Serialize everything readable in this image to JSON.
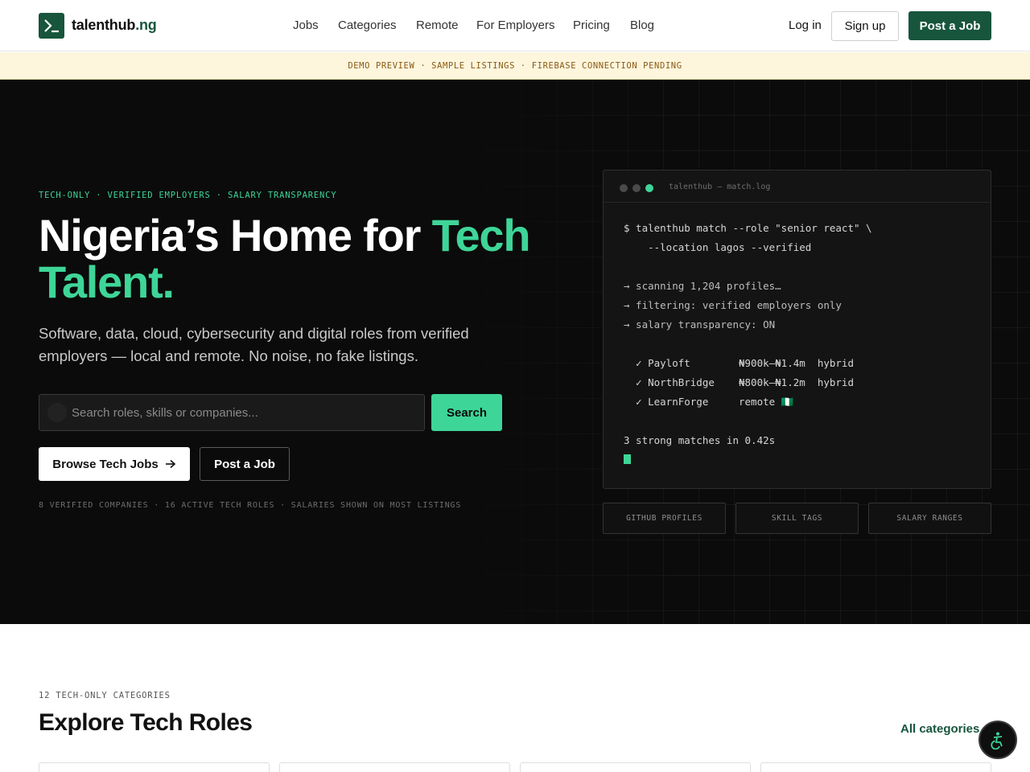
{
  "header": {
    "logo_main": "talenthub",
    "logo_tld": ".ng",
    "nav": [
      "Jobs",
      "Categories",
      "Remote",
      "For Employers",
      "Pricing",
      "Blog"
    ],
    "login": "Log in",
    "signup": "Sign up",
    "post_job": "Post a Job"
  },
  "banner": "DEMO PREVIEW · SAMPLE LISTINGS · FIREBASE CONNECTION PENDING",
  "hero": {
    "kicker": "TECH-ONLY · VERIFIED EMPLOYERS · SALARY TRANSPARENCY",
    "title_part1": "Nigeria’s Home for ",
    "title_accent": "Tech Talent.",
    "subtitle": "Software, data, cloud, cybersecurity and digital roles from verified employers — local and remote. No noise, no fake listings.",
    "search_placeholder": "Search roles, skills or companies...",
    "search_button": "Search",
    "browse_button": "Browse Tech Jobs",
    "post_button": "Post a Job",
    "stats": "8 VERIFIED COMPANIES · 16 ACTIVE TECH ROLES · SALARIES SHOWN ON MOST LISTINGS"
  },
  "terminal": {
    "title": "talenthub — match.log",
    "lines": [
      "$ talenthub match --role \"senior react\" \\",
      "    --location lagos --verified",
      "→ scanning 1,204 profiles…",
      "→ filtering: verified employers only",
      "→ salary transparency: ON",
      "  ✓ Payloft        ₦900k–₦1.4m  hybrid",
      "  ✓ NorthBridge    ₦800k–₦1.2m  hybrid",
      "  ✓ LearnForge     remote 🇳🇬",
      "3 strong matches in 0.42s"
    ],
    "chips": [
      "GITHUB PROFILES",
      "SKILL TAGS",
      "SALARY RANGES"
    ]
  },
  "categories": {
    "kicker": "12 TECH-ONLY CATEGORIES",
    "title": "Explore Tech Roles",
    "all_link": "All categories"
  },
  "colors": {
    "brand": "#17553d",
    "accent": "#3ed598",
    "hero_bg": "#0b0b0b",
    "banner_bg": "#fdf6dd"
  }
}
